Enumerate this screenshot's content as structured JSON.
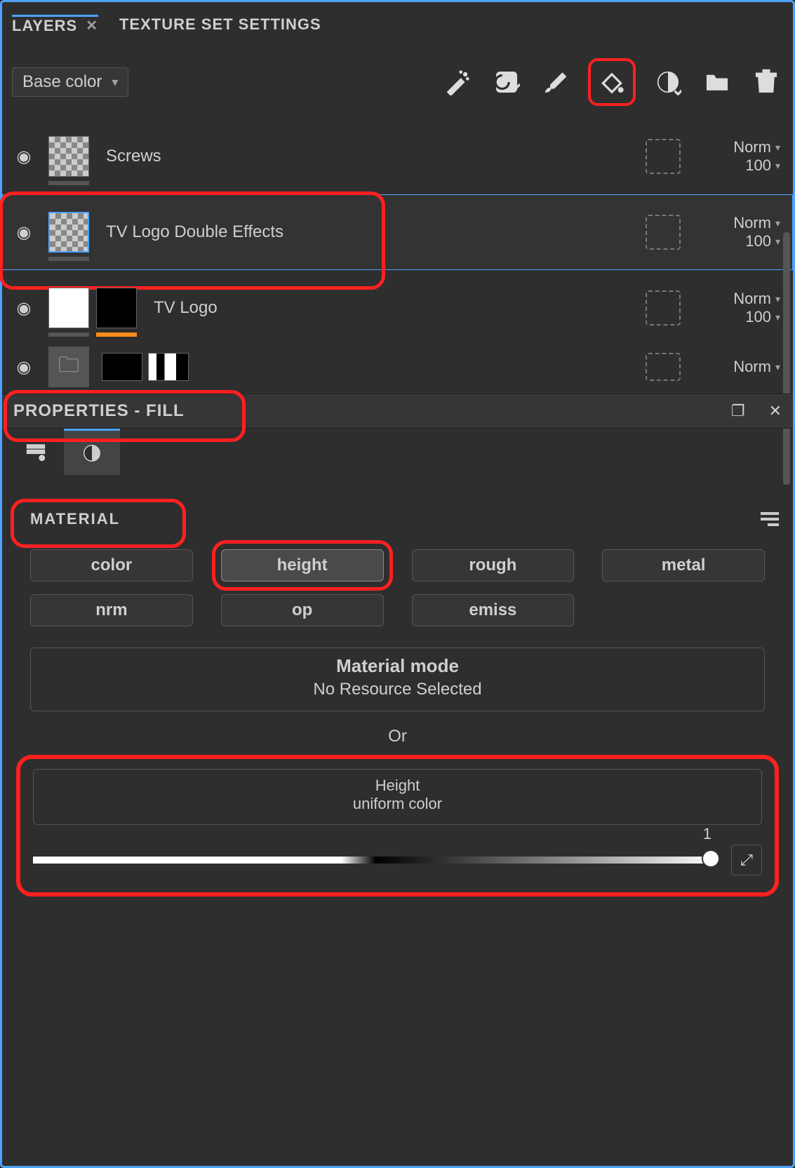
{
  "highlight_color": "#ff2020",
  "tabs": {
    "layers": "LAYERS",
    "texture": "TEXTURE SET SETTINGS"
  },
  "channel_selector": {
    "value": "Base color"
  },
  "tools": {
    "wand": "magic-wand-icon",
    "fill_layer": "reload-checked-icon",
    "brush": "brush-icon",
    "paint_bucket": "paint-bucket-icon",
    "smart_material": "smart-material-icon",
    "folder": "folder-icon",
    "trash": "trash-icon"
  },
  "layers": [
    {
      "name": "Screws",
      "visible": true,
      "thumb": "checker",
      "mask": true,
      "blend_mode": "Norm",
      "opacity": 100,
      "selected": false,
      "highlighted": false
    },
    {
      "name": "TV Logo Double Effects",
      "visible": true,
      "thumb": "checker",
      "mask": true,
      "blend_mode": "Norm",
      "opacity": 100,
      "selected": true,
      "highlighted": true
    },
    {
      "name": "TV Logo",
      "visible": true,
      "thumb": "white",
      "thumb2": "black",
      "underbar": "orange",
      "mask": true,
      "blend_mode": "Norm",
      "opacity": 100,
      "selected": false,
      "highlighted": false
    },
    {
      "name": "",
      "visible": true,
      "thumb": "folder",
      "mask": true,
      "blend_mode": "Norm",
      "opacity": null,
      "selected": false,
      "highlighted": false
    }
  ],
  "properties": {
    "title": "PROPERTIES - FILL"
  },
  "material": {
    "title": "MATERIAL",
    "channels": {
      "color": "color",
      "height": "height",
      "rough": "rough",
      "metal": "metal",
      "nrm": "nrm",
      "op": "op",
      "emiss": "emiss"
    },
    "mode_title": "Material mode",
    "mode_value": "No Resource Selected",
    "or": "Or",
    "height_title": "Height",
    "height_sub": "uniform color",
    "height_value": 1
  }
}
